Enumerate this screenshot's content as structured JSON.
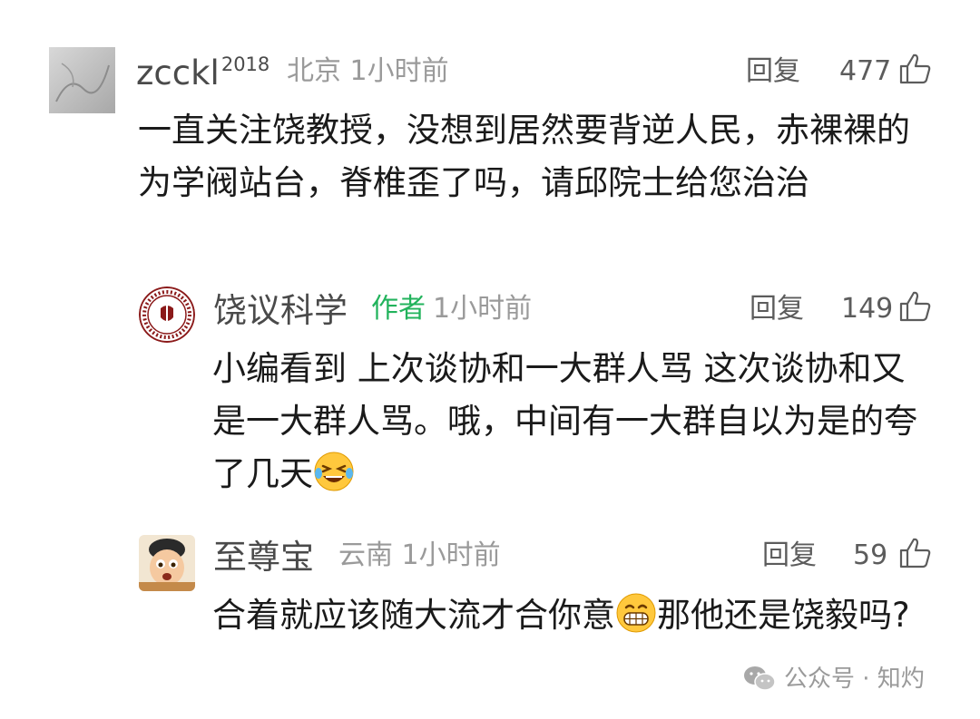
{
  "comments": [
    {
      "username": "zcckl",
      "username_sup": "2018",
      "location": "北京",
      "time": "1小时前",
      "reply_label": "回复",
      "likes": "477",
      "avatar": "grey-sketch-photo",
      "text": "一直关注饶教授，没想到居然要背逆人民，赤裸裸的为学阀站台，脊椎歪了吗，请邱院士给您治治"
    },
    {
      "username": "饶议科学",
      "author_tag": "作者",
      "time": "1小时前",
      "reply_label": "回复",
      "likes": "149",
      "avatar": "university-seal-logo",
      "text": "小编看到 上次谈协和一大群人骂 这次谈协和又是一大群人骂。哦，中间有一大群自以为是的夸了几天",
      "emoji": "laughing-tears-emoji"
    },
    {
      "username": "至尊宝",
      "location": "云南",
      "time": "1小时前",
      "reply_label": "回复",
      "likes": "59",
      "avatar": "cartoon-character",
      "text_before": "合着就应该随大流才合你意",
      "emoji": "grinning-emoji",
      "text_after": "那他还是饶毅吗?"
    }
  ],
  "watermark": {
    "icon": "wechat-icon",
    "text": "公众号 · 知灼"
  }
}
